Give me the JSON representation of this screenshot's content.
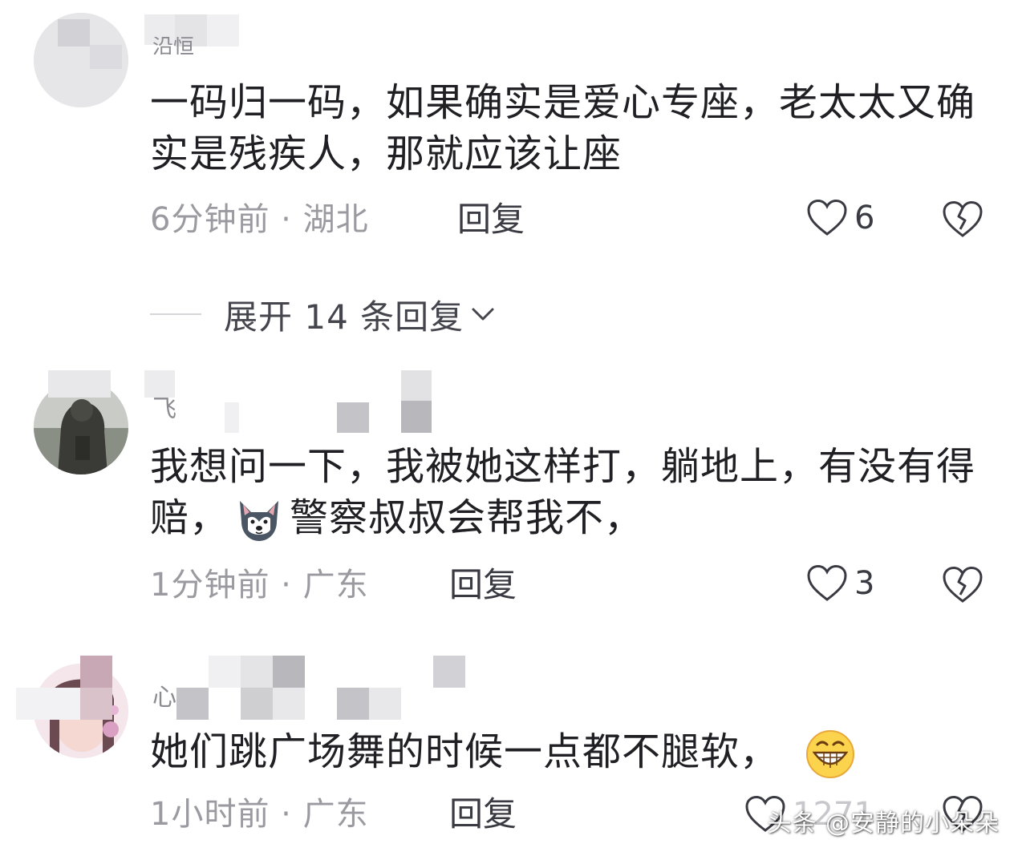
{
  "comments": [
    {
      "username": "沿恒",
      "text": "一码归一码，如果确实是爱心专座，老太太又确实是残疾人，那就应该让座",
      "time_location": "6分钟前 · 湖北",
      "reply_label": "回复",
      "like_count": "6"
    },
    {
      "username": "飞",
      "text_before_emoji": "我想问一下，我被她这样打，躺地上，有没有得赔，",
      "text_after_emoji": "警察叔叔会帮我不，",
      "emoji_icon": "husky-dog-emoji-icon",
      "time_location": "1分钟前 · 广东",
      "reply_label": "回复",
      "like_count": "3"
    },
    {
      "username": "心",
      "text_before_emoji": "她们跳广场舞的时候一点都不腿软，",
      "emoji_icon": "grinning-face-emoji-icon",
      "time_location": "1小时前 · 广东",
      "reply_label": "回复",
      "like_count": "1271"
    }
  ],
  "expand_replies_label": "展开 14 条回复",
  "watermark": "头条 @安静的小朵朵",
  "colors": {
    "text_primary": "#1f1f24",
    "text_secondary": "#9a9aa0",
    "icon": "#3a3a42",
    "divider": "#d6d6da"
  }
}
